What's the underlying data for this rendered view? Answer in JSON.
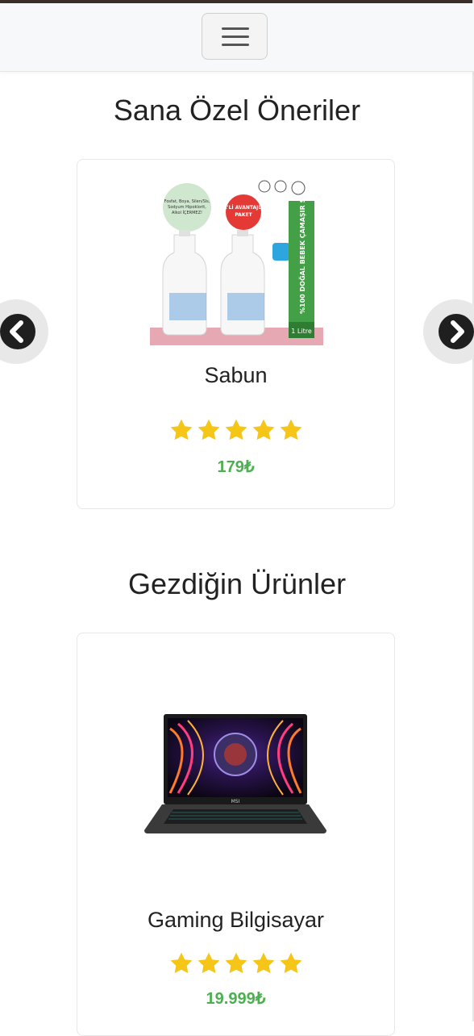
{
  "navbar": {
    "menu_icon": "hamburger-menu-icon"
  },
  "sections": {
    "recommendations": {
      "title": "Sana Özel Öneriler",
      "product": {
        "name": "Sabun",
        "rating": 5,
        "rating_max": 5,
        "price": "179₺",
        "image_badge_1": "2'Lİ AVANTAJLI PAKET",
        "image_side_text": "%100 DOĞAL BEBEK ÇAMAŞIR SABUNU",
        "image_volume": "1 Litre"
      },
      "prev_icon": "chevron-left-icon",
      "next_icon": "chevron-right-icon"
    },
    "viewed": {
      "title": "Gezdiğin Ürünler",
      "product": {
        "name": "Gaming Bilgisayar",
        "rating": 5,
        "rating_max": 5,
        "price": "19.999₺",
        "image_brand": "MSI"
      }
    }
  },
  "colors": {
    "price": "#4caf50",
    "star": "#f5c518",
    "navbar_bg": "#f7f8f9"
  }
}
